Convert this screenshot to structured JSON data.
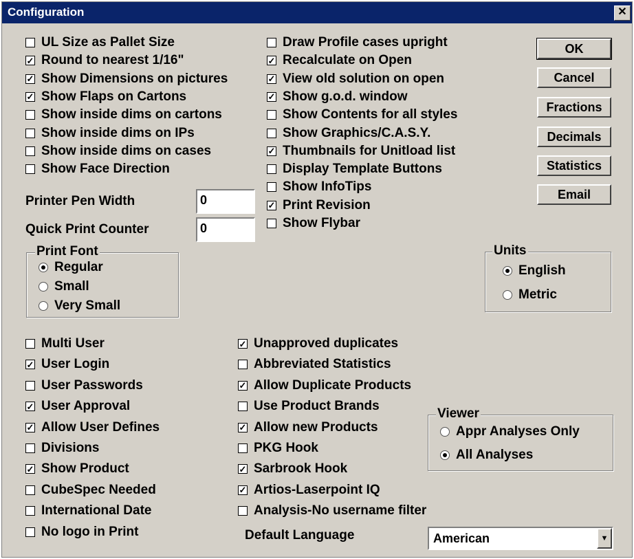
{
  "window": {
    "title": "Configuration",
    "close_glyph": "✕"
  },
  "options_left": [
    {
      "label": "UL Size as Pallet Size",
      "checked": false
    },
    {
      "label": "Round to nearest 1/16\"",
      "checked": true
    },
    {
      "label": "Show Dimensions on pictures",
      "checked": true
    },
    {
      "label": "Show Flaps on Cartons",
      "checked": true
    },
    {
      "label": "Show inside dims on cartons",
      "checked": false
    },
    {
      "label": "Show inside dims on IPs",
      "checked": false
    },
    {
      "label": "Show inside dims on cases",
      "checked": false
    },
    {
      "label": "Show Face Direction",
      "checked": false
    }
  ],
  "options_mid": [
    {
      "label": "Draw Profile cases upright",
      "checked": false
    },
    {
      "label": "Recalculate on Open",
      "checked": true
    },
    {
      "label": "View old solution on open",
      "checked": true
    },
    {
      "label": "Show g.o.d. window",
      "checked": true
    },
    {
      "label": "Show Contents for all styles",
      "checked": false
    },
    {
      "label": "Show Graphics/C.A.S.Y.",
      "checked": false
    },
    {
      "label": "Thumbnails for Unitload list",
      "checked": true
    },
    {
      "label": "Display Template Buttons",
      "checked": false
    },
    {
      "label": "Show InfoTips",
      "checked": false
    },
    {
      "label": "Print Revision",
      "checked": true
    },
    {
      "label": "Show Flybar",
      "checked": false
    }
  ],
  "buttons": {
    "ok": "OK",
    "cancel": "Cancel",
    "fractions": "Fractions",
    "decimals": "Decimals",
    "statistics": "Statistics",
    "email": "Email"
  },
  "printer_pen_width": {
    "label": "Printer Pen Width",
    "value": "0"
  },
  "quick_print_counter": {
    "label": "Quick Print Counter",
    "value": "0"
  },
  "print_font": {
    "title": "Print Font",
    "options": [
      {
        "label": "Regular",
        "selected": true
      },
      {
        "label": "Small",
        "selected": false
      },
      {
        "label": "Very Small",
        "selected": false
      }
    ]
  },
  "units": {
    "title": "Units",
    "options": [
      {
        "label": "English",
        "selected": true
      },
      {
        "label": "Metric",
        "selected": false
      }
    ]
  },
  "options_bottom_left": [
    {
      "label": "Multi User",
      "checked": false
    },
    {
      "label": "User Login",
      "checked": true
    },
    {
      "label": "User Passwords",
      "checked": false
    },
    {
      "label": "User Approval",
      "checked": true
    },
    {
      "label": "Allow User Defines",
      "checked": true
    },
    {
      "label": "Divisions",
      "checked": false
    },
    {
      "label": "Show Product",
      "checked": true
    },
    {
      "label": "CubeSpec Needed",
      "checked": false
    },
    {
      "label": "International Date",
      "checked": false
    },
    {
      "label": "No logo in Print",
      "checked": false
    }
  ],
  "options_bottom_mid": [
    {
      "label": "Unapproved duplicates",
      "checked": true
    },
    {
      "label": "Abbreviated Statistics",
      "checked": false
    },
    {
      "label": "Allow Duplicate Products",
      "checked": true
    },
    {
      "label": "Use Product Brands",
      "checked": false
    },
    {
      "label": "Allow new Products",
      "checked": true
    },
    {
      "label": "PKG Hook",
      "checked": false
    },
    {
      "label": "Sarbrook Hook",
      "checked": true
    },
    {
      "label": "Artios-Laserpoint IQ",
      "checked": true
    },
    {
      "label": "Analysis-No username filter",
      "checked": false
    }
  ],
  "viewer": {
    "title": "Viewer",
    "options": [
      {
        "label": "Appr Analyses Only",
        "selected": false
      },
      {
        "label": "All Analyses",
        "selected": true
      }
    ]
  },
  "default_language": {
    "label": "Default Language",
    "value": "American"
  }
}
